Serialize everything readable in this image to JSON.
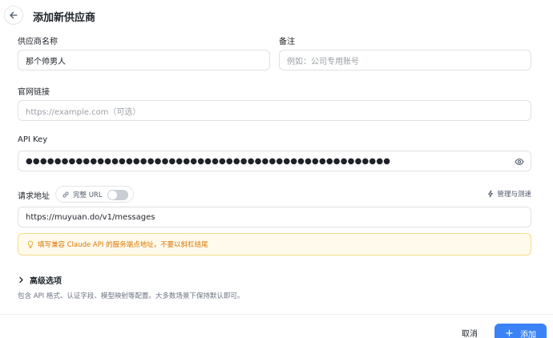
{
  "header": {
    "title": "添加新供应商",
    "back_icon": "arrow-left-icon"
  },
  "form": {
    "name": {
      "label": "供应商名称",
      "value": "那个帅男人"
    },
    "note": {
      "label": "备注",
      "placeholder": "例如：公司专用账号"
    },
    "website": {
      "label": "官网链接",
      "placeholder": "https://example.com（可选）"
    },
    "api_key": {
      "label": "API Key",
      "masked_value": "●●●●●●●●●●●●●●●●●●●●●●●●●●●●●●●●●●●●●●●●●●●●●●●●●●●",
      "toggle_icon": "eye-icon"
    },
    "endpoint": {
      "label": "请求地址",
      "full_url_label": "完整 URL",
      "full_url_enabled": false,
      "manage_label": "管理与测速",
      "value": "https://muyuan.do/v1/messages",
      "hint": "填写兼容 Claude API 的服务端点地址，不要以斜杠结尾"
    },
    "advanced": {
      "label": "高级选项",
      "description": "包含 API 格式、认证字段、模型映射等配置。大多数场景下保持默认即可。"
    }
  },
  "footer": {
    "cancel_label": "取消",
    "add_label": "添加",
    "add_icon": "+"
  },
  "colors": {
    "primary": "#3b82f6",
    "hint_text": "#d97706",
    "hint_bg": "#fffaeb",
    "hint_border": "#f6dc8e"
  }
}
